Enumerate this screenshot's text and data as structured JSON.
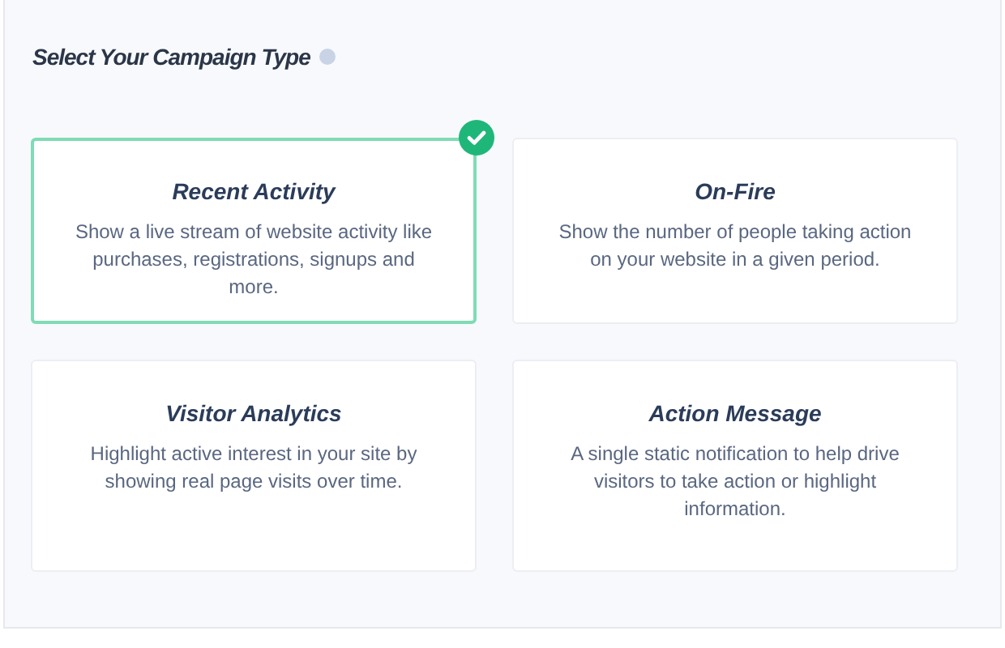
{
  "title": "Select Your Campaign Type",
  "campaign_types": [
    {
      "name": "Recent Activity",
      "description": "Show a live stream of website activity like purchases, registrations, signups and more.",
      "selected": true
    },
    {
      "name": "On-Fire",
      "description": "Show the number of people taking action on your website in a given period.",
      "selected": false
    },
    {
      "name": "Visitor Analytics",
      "description": "Highlight active interest in your site by showing real page visits over time.",
      "selected": false
    },
    {
      "name": "Action Message",
      "description": "A single static notification to help drive visitors to take action or highlight information.",
      "selected": false
    }
  ]
}
